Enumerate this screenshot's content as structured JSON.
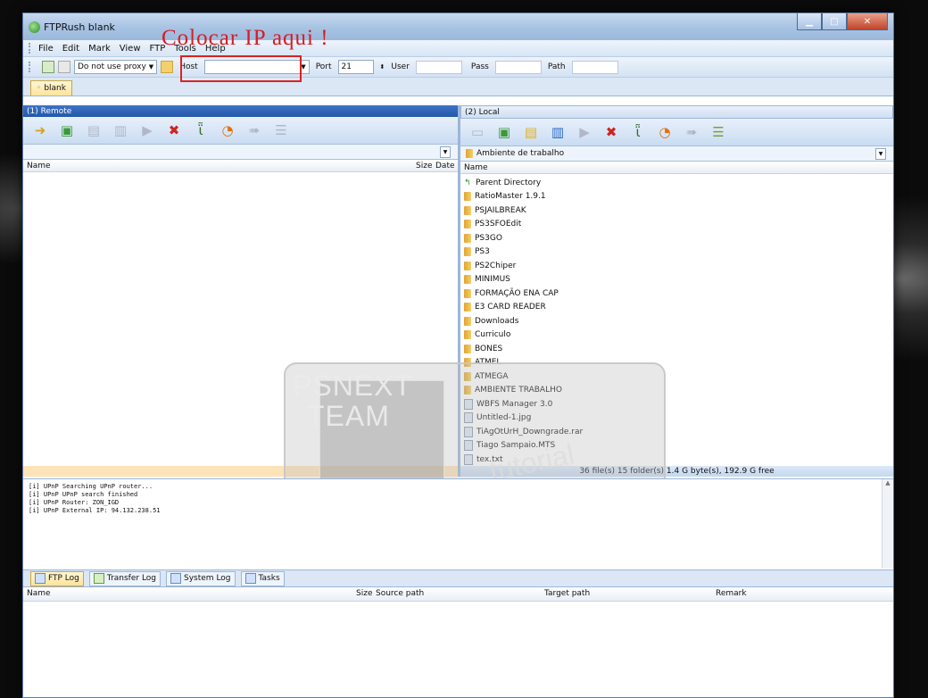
{
  "window": {
    "title": "FTPRush  blank"
  },
  "annotation": {
    "text": "Colocar IP aqui !"
  },
  "menu": [
    "File",
    "Edit",
    "Mark",
    "View",
    "FTP",
    "Tools",
    "Help"
  ],
  "connection": {
    "proxy_value": "Do not use proxy",
    "host_label": "Host",
    "host_value": "",
    "port_label": "Port",
    "port_value": "21",
    "user_label": "User",
    "pass_label": "Pass",
    "path_label": "Path"
  },
  "tab": {
    "label": "blank"
  },
  "remote": {
    "header": "(1) Remote",
    "columns": {
      "name": "Name",
      "size": "Size",
      "date": "Date"
    }
  },
  "local": {
    "header": "(2) Local",
    "path": "Ambiente de trabalho",
    "columns": {
      "name": "Name"
    },
    "files": [
      {
        "name": "Parent Directory",
        "kind": "parent"
      },
      {
        "name": "RatioMaster 1.9.1",
        "kind": "folder"
      },
      {
        "name": "PSJAILBREAK",
        "kind": "folder"
      },
      {
        "name": "PS3SFOEdit",
        "kind": "folder"
      },
      {
        "name": "PS3GO",
        "kind": "folder"
      },
      {
        "name": "PS3",
        "kind": "folder"
      },
      {
        "name": "PS2Chiper",
        "kind": "folder"
      },
      {
        "name": "MINIMUS",
        "kind": "folder"
      },
      {
        "name": "FORMAÇÃO ENA CAP",
        "kind": "folder"
      },
      {
        "name": "E3 CARD READER",
        "kind": "folder"
      },
      {
        "name": "Downloads",
        "kind": "folder"
      },
      {
        "name": "Curriculo",
        "kind": "folder"
      },
      {
        "name": "BONES",
        "kind": "folder"
      },
      {
        "name": "ATMEL",
        "kind": "folder"
      },
      {
        "name": "ATMEGA",
        "kind": "folder"
      },
      {
        "name": "AMBIENTE TRABALHO",
        "kind": "folder"
      },
      {
        "name": "WBFS Manager 3.0",
        "kind": "file"
      },
      {
        "name": "Untitled-1.jpg",
        "kind": "file"
      },
      {
        "name": "TiAgOtUrH_Downgrade.rar",
        "kind": "file"
      },
      {
        "name": "Tiago Sampaio.MTS",
        "kind": "file"
      },
      {
        "name": "tex.txt",
        "kind": "file"
      }
    ],
    "status": "36 file(s) 15 folder(s) 1.4 G byte(s), 192.9 G free"
  },
  "watermark": {
    "line1": "PSNEXT",
    "line2": "TEAM",
    "line3": "tutorial"
  },
  "log": {
    "lines": [
      "[i] UPnP Searching UPnP router...",
      "[i] UPnP UPnP search finished",
      "[i] UPnP Router: ZON_IGD",
      "[i] UPnP External IP: 94.132.238.51"
    ]
  },
  "log_tabs": [
    "FTP Log",
    "Transfer Log",
    "System Log",
    "Tasks"
  ],
  "transfer": {
    "columns": {
      "name": "Name",
      "size": "Size",
      "source": "Source path",
      "target": "Target path",
      "remark": "Remark"
    }
  }
}
